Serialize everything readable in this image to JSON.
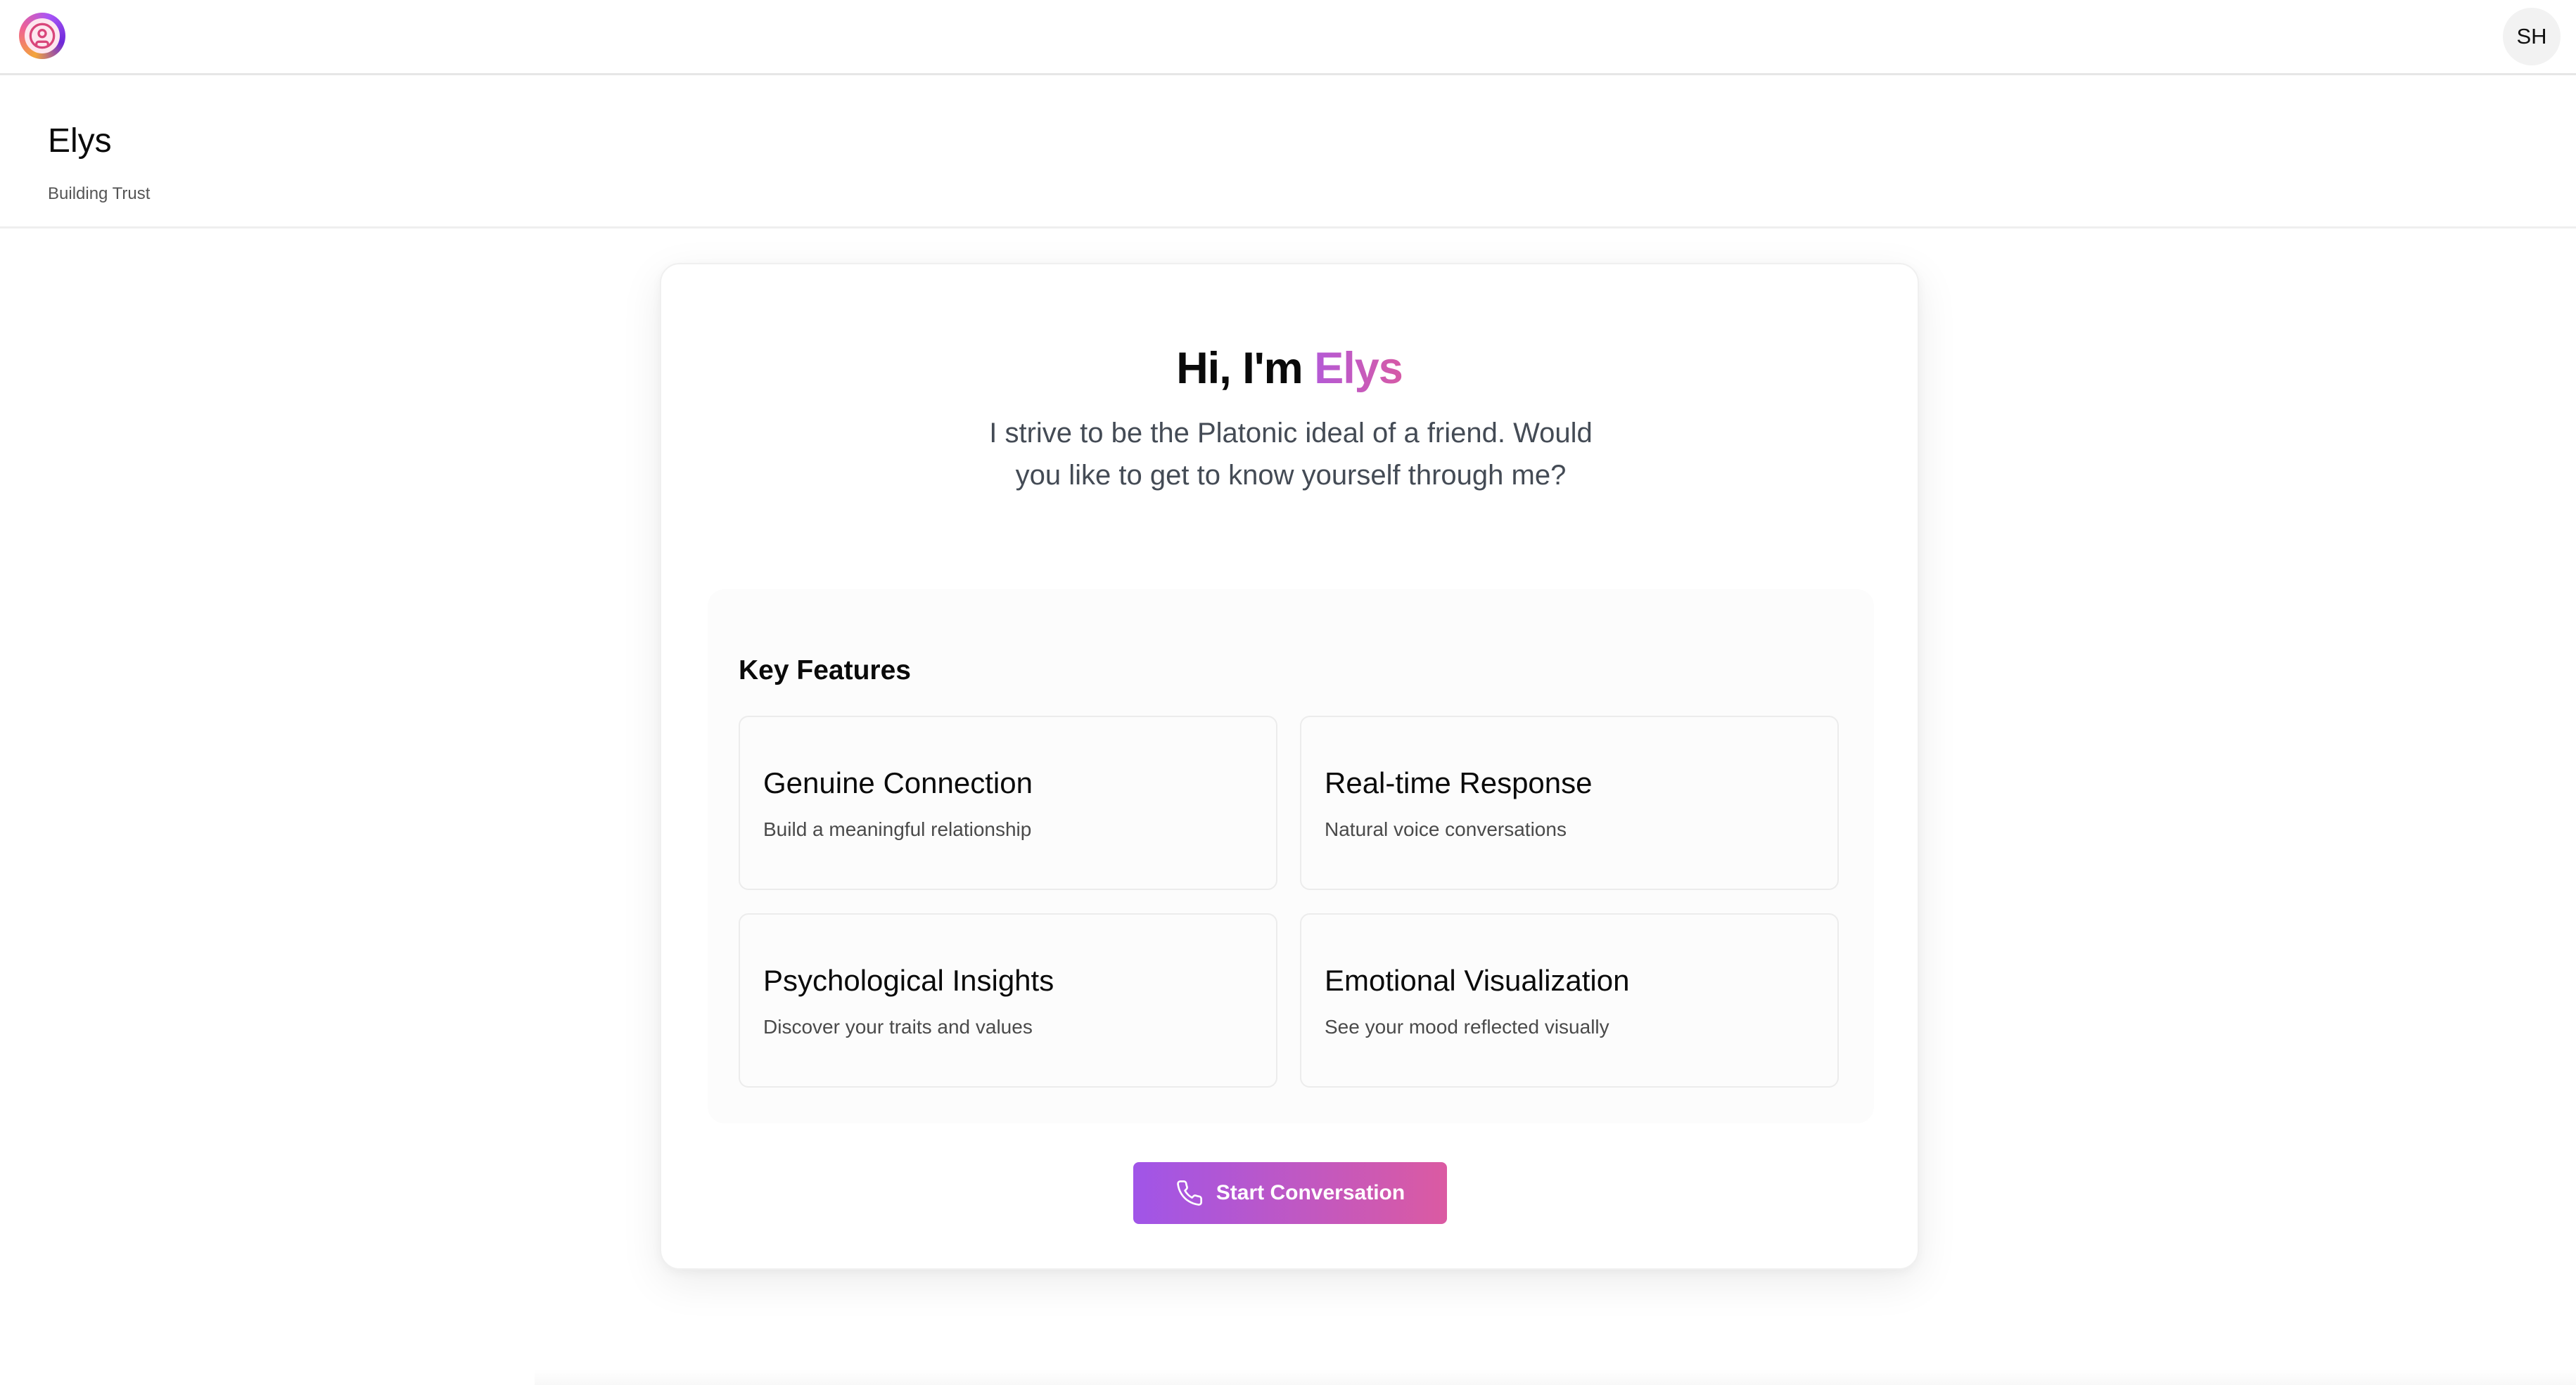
{
  "topbar": {
    "logo_icon": "user-circle-icon",
    "avatar_initials": "SH"
  },
  "header": {
    "title": "Elys",
    "subtitle": "Building Trust"
  },
  "hero": {
    "greeting": "Hi, I'm ",
    "name": "Elys",
    "description": "I strive to be the Platonic ideal of a friend. Would you like to get to know yourself through me?"
  },
  "features": {
    "heading": "Key Features",
    "items": [
      {
        "title": "Genuine Connection",
        "description": "Build a meaningful relationship"
      },
      {
        "title": "Real-time Response",
        "description": "Natural voice conversations"
      },
      {
        "title": "Psychological Insights",
        "description": "Discover your traits and values"
      },
      {
        "title": "Emotional Visualization",
        "description": "See your mood reflected visually"
      }
    ]
  },
  "cta": {
    "label": "Start Conversation",
    "icon": "phone-icon"
  },
  "colors": {
    "accent_start": "#a055e8",
    "accent_end": "#db5aa2",
    "name_gradient_start": "#b45ad6",
    "name_gradient_end": "#d65aa6"
  }
}
